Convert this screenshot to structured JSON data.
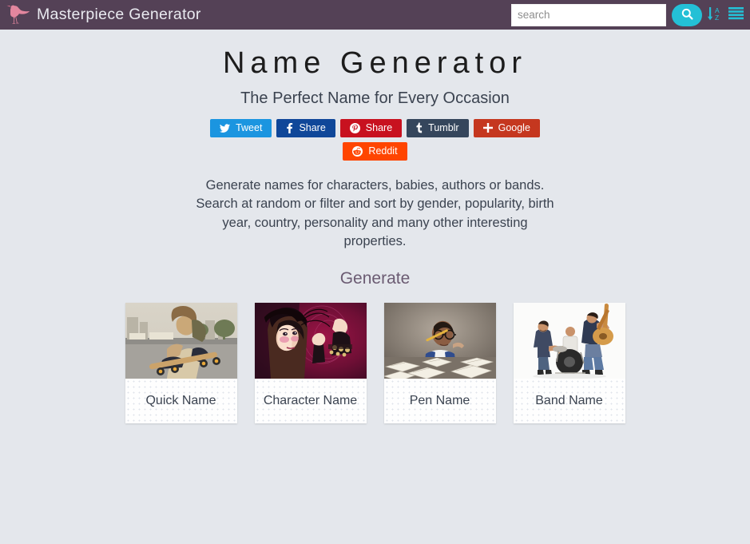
{
  "header": {
    "brand": "Masterpiece Generator",
    "logo_icon": "flamingo-icon",
    "search": {
      "placeholder": "search",
      "value": "",
      "button_icon": "search-icon"
    },
    "sort_icon": "sort-alpha-down-icon",
    "menu_icon": "list-menu-icon",
    "bar_color": "#544156",
    "accent_color": "#24c0d6"
  },
  "main": {
    "title": "Name Generator",
    "subtitle": "The Perfect Name for Every Occasion",
    "description": "Generate names for characters, babies, authors or bands. Search at random or filter and sort by gender, popularity, birth year, country, personality and many other interesting properties.",
    "section_heading": "Generate"
  },
  "social": {
    "buttons": [
      {
        "label": "Tweet",
        "icon": "twitter-bird-icon",
        "glyph": "🐦",
        "color": "#1b95e0",
        "row": 1
      },
      {
        "label": "Share",
        "icon": "facebook-icon",
        "glyph": "f",
        "color": "#0f4799",
        "row": 1
      },
      {
        "label": "Share",
        "icon": "pinterest-icon",
        "glyph": "P",
        "color": "#c8111f",
        "row": 1
      },
      {
        "label": "Tumblr",
        "icon": "tumblr-icon",
        "glyph": "t",
        "color": "#35465c",
        "row": 1
      },
      {
        "label": "Google",
        "icon": "google-plus-icon",
        "glyph": "+",
        "color": "#c5371f",
        "row": 1
      },
      {
        "label": "Reddit",
        "icon": "reddit-alien-icon",
        "glyph": "Ⓡ",
        "color": "#ff4500",
        "row": 2
      }
    ]
  },
  "cards": [
    {
      "label": "Quick Name",
      "image": "skateboarder-photo"
    },
    {
      "label": "Character Name",
      "image": "gothic-fantasy-portrait-photo"
    },
    {
      "label": "Pen Name",
      "image": "writer-with-books-photo"
    },
    {
      "label": "Band Name",
      "image": "band-playing-photo"
    }
  ],
  "theme": {
    "page_background": "#e4e7ec",
    "heading_color": "#6b5b72",
    "text_color": "#3b4350"
  }
}
